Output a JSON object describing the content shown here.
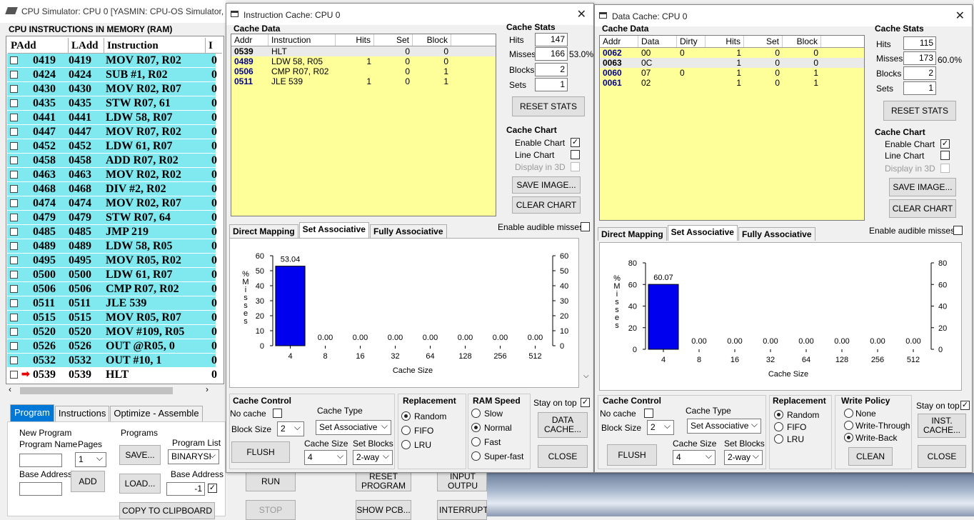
{
  "main": {
    "title": "CPU Simulator: CPU 0    [YASMIN: CPU-OS Simulator,",
    "ram_header": "CPU INSTRUCTIONS IN MEMORY (RAM)",
    "ram_cols": [
      "PAdd",
      "LAdd",
      "Instruction",
      "I"
    ],
    "rows": [
      {
        "p": "0419",
        "l": "0419",
        "i": "MOV R07, R02",
        "x": "0"
      },
      {
        "p": "0424",
        "l": "0424",
        "i": "SUB #1, R02",
        "x": "0"
      },
      {
        "p": "0430",
        "l": "0430",
        "i": "MOV R02, R07",
        "x": "0"
      },
      {
        "p": "0435",
        "l": "0435",
        "i": "STW R07, 61",
        "x": "0"
      },
      {
        "p": "0441",
        "l": "0441",
        "i": "LDW 58, R07",
        "x": "0"
      },
      {
        "p": "0447",
        "l": "0447",
        "i": "MOV R07, R02",
        "x": "0"
      },
      {
        "p": "0452",
        "l": "0452",
        "i": "LDW 61, R07",
        "x": "0"
      },
      {
        "p": "0458",
        "l": "0458",
        "i": "ADD R07, R02",
        "x": "0"
      },
      {
        "p": "0463",
        "l": "0463",
        "i": "MOV R02, R02",
        "x": "0"
      },
      {
        "p": "0468",
        "l": "0468",
        "i": "DIV #2, R02",
        "x": "0"
      },
      {
        "p": "0474",
        "l": "0474",
        "i": "MOV R02, R07",
        "x": "0"
      },
      {
        "p": "0479",
        "l": "0479",
        "i": "STW R07, 64",
        "x": "0"
      },
      {
        "p": "0485",
        "l": "0485",
        "i": "JMP 219",
        "x": "0"
      },
      {
        "p": "0489",
        "l": "0489",
        "i": "LDW 58, R05",
        "x": "0"
      },
      {
        "p": "0495",
        "l": "0495",
        "i": "MOV R05, R02",
        "x": "0"
      },
      {
        "p": "0500",
        "l": "0500",
        "i": "LDW 61, R07",
        "x": "0"
      },
      {
        "p": "0506",
        "l": "0506",
        "i": "CMP R07, R02",
        "x": "0"
      },
      {
        "p": "0511",
        "l": "0511",
        "i": "JLE 539",
        "x": "0"
      },
      {
        "p": "0515",
        "l": "0515",
        "i": "MOV R05, R07",
        "x": "0"
      },
      {
        "p": "0520",
        "l": "0520",
        "i": "MOV #109, R05",
        "x": "0"
      },
      {
        "p": "0526",
        "l": "0526",
        "i": "OUT @R05, 0",
        "x": "0"
      },
      {
        "p": "0532",
        "l": "0532",
        "i": "OUT #10, 1",
        "x": "0"
      },
      {
        "p": "0539",
        "l": "0539",
        "i": "HLT",
        "x": "0"
      }
    ],
    "tabs": [
      "Program",
      "Instructions",
      "Optimize - Assemble"
    ],
    "new_program": "New Program",
    "program_name": "Program Name",
    "pages": "Pages",
    "pages_val": "1",
    "base_address": "Base Address",
    "add": "ADD",
    "programs": "Programs",
    "save": "SAVE...",
    "load": "LOAD...",
    "program_list": "Program List",
    "program_list_val": "BINARYSI",
    "base_address2": "Base Address",
    "base_val": "-1",
    "copy": "COPY TO CLIPBOARD",
    "run": "RUN",
    "stop": "STOP",
    "reset_program": "RESET PROGRAM",
    "show_pcb": "SHOW PCB...",
    "input_output": "INPUT OUTPU",
    "interrupt": "INTERRUPT"
  },
  "icache": {
    "title": "Instruction Cache: CPU 0",
    "cache_data": "Cache Data",
    "cols": [
      "Addr",
      "Instruction",
      "Hits",
      "Set",
      "Block"
    ],
    "rows": [
      {
        "a": "0539",
        "b": "HLT",
        "c": "",
        "d": "0",
        "e": "0"
      },
      {
        "a": "0489",
        "b": "LDW 58, R05",
        "c": "1",
        "d": "0",
        "e": "0"
      },
      {
        "a": "0506",
        "b": "CMP R07, R02",
        "c": "",
        "d": "0",
        "e": "1"
      },
      {
        "a": "0511",
        "b": "JLE 539",
        "c": "1",
        "d": "0",
        "e": "1"
      }
    ],
    "stats_title": "Cache Stats",
    "hits_lbl": "Hits",
    "hits": "147",
    "misses_lbl": "Misses",
    "misses": "166",
    "miss_pct": "53.0%",
    "blocks_lbl": "Blocks",
    "blocks": "2",
    "sets_lbl": "Sets",
    "sets": "1",
    "reset_stats": "RESET STATS",
    "chart_title": "Cache Chart",
    "enable_chart": "Enable Chart",
    "line_chart": "Line Chart",
    "display3d": "Display in 3D",
    "save_image": "SAVE IMAGE...",
    "clear_chart": "CLEAR CHART",
    "tabs": [
      "Direct Mapping",
      "Set Associative",
      "Fully Associative"
    ],
    "audible": "Enable audible misses",
    "control_title": "Cache Control",
    "no_cache": "No cache",
    "block_size": "Block Size",
    "block_size_val": "2",
    "cache_type": "Cache Type",
    "cache_type_val": "Set Associative",
    "cache_size": "Cache Size",
    "cache_size_val": "4",
    "set_blocks": "Set Blocks",
    "set_blocks_val": "2-way",
    "flush": "FLUSH",
    "repl_title": "Replacement",
    "repl": [
      "Random",
      "FIFO",
      "LRU"
    ],
    "ram_title": "RAM Speed",
    "ram": [
      "Slow",
      "Normal",
      "Fast",
      "Super-fast"
    ],
    "stay": "Stay on top",
    "data_cache_btn": "DATA CACHE...",
    "close": "CLOSE"
  },
  "dcache": {
    "title": "Data Cache: CPU 0",
    "cache_data": "Cache Data",
    "cols": [
      "Addr",
      "Data",
      "Dirty",
      "Hits",
      "Set",
      "Block"
    ],
    "rows": [
      {
        "a": "0062",
        "b": "00",
        "c": "0",
        "d": "1",
        "e": "0",
        "f": "0"
      },
      {
        "a": "0063",
        "b": "0C",
        "c": "",
        "d": "1",
        "e": "0",
        "f": "0"
      },
      {
        "a": "0060",
        "b": "07",
        "c": "0",
        "d": "1",
        "e": "0",
        "f": "1"
      },
      {
        "a": "0061",
        "b": "02",
        "c": "",
        "d": "1",
        "e": "0",
        "f": "1"
      }
    ],
    "stats_title": "Cache Stats",
    "hits_lbl": "Hits",
    "hits": "115",
    "misses_lbl": "Misses",
    "misses": "173",
    "miss_pct": "60.0%",
    "blocks_lbl": "Blocks",
    "blocks": "2",
    "sets_lbl": "Sets",
    "sets": "1",
    "reset_stats": "RESET STATS",
    "chart_title": "Cache Chart",
    "enable_chart": "Enable Chart",
    "line_chart": "Line Chart",
    "display3d": "Display in 3D",
    "save_image": "SAVE IMAGE...",
    "clear_chart": "CLEAR CHART",
    "tabs": [
      "Direct Mapping",
      "Set Associative",
      "Fully Associative"
    ],
    "audible": "Enable audible misses",
    "control_title": "Cache Control",
    "no_cache": "No cache",
    "block_size": "Block Size",
    "block_size_val": "2",
    "cache_type": "Cache Type",
    "cache_type_val": "Set Associative",
    "cache_size": "Cache Size",
    "cache_size_val": "4",
    "set_blocks": "Set Blocks",
    "set_blocks_val": "2-way",
    "flush": "FLUSH",
    "repl_title": "Replacement",
    "repl": [
      "Random",
      "FIFO",
      "LRU"
    ],
    "wp_title": "Write Policy",
    "wp": [
      "None",
      "Write-Through",
      "Write-Back"
    ],
    "clean": "CLEAN",
    "stay": "Stay on top",
    "inst_cache_btn": "INST. CACHE...",
    "close": "CLOSE"
  },
  "chart_data": [
    {
      "type": "bar",
      "categories": [
        "4",
        "8",
        "16",
        "32",
        "64",
        "128",
        "256",
        "512"
      ],
      "values": [
        53.04,
        0,
        0,
        0,
        0,
        0,
        0,
        0
      ],
      "labels": [
        "53.04",
        "0.00",
        "0.00",
        "0.00",
        "0.00",
        "0.00",
        "0.00",
        "0.00"
      ],
      "xlabel": "Cache Size",
      "ylabel": "% Misses",
      "ylim": [
        0,
        60
      ],
      "yticks": [
        0,
        10,
        20,
        30,
        40,
        50,
        60
      ],
      "color": "#0000ee"
    },
    {
      "type": "bar",
      "categories": [
        "4",
        "8",
        "16",
        "32",
        "64",
        "128",
        "256",
        "512"
      ],
      "values": [
        60.07,
        0,
        0,
        0,
        0,
        0,
        0,
        0
      ],
      "labels": [
        "60.07",
        "0.00",
        "0.00",
        "0.00",
        "0.00",
        "0.00",
        "0.00",
        "0.00"
      ],
      "xlabel": "Cache Size",
      "ylabel": "% Misses",
      "ylim": [
        0,
        80
      ],
      "yticks": [
        0,
        20,
        40,
        60,
        80
      ],
      "color": "#0000ee"
    }
  ]
}
